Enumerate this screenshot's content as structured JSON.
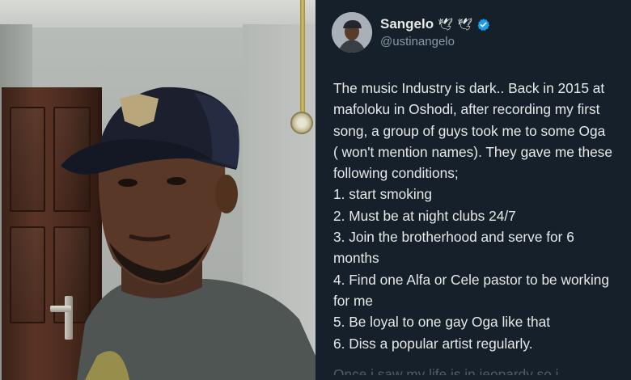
{
  "tweet": {
    "display_name": "Sangelo",
    "name_emojis": [
      "🕊",
      "🕊"
    ],
    "verified": true,
    "handle": "@ustinangelo",
    "lines": [
      "The music Industry is dark.. Back in 2015 at",
      "mafoloku in Oshodi, after recording my first",
      "song,  a group of guys took me to some Oga",
      "( won't mention names). They gave me these",
      "following conditions;",
      "1.  start smoking",
      "2. Must be at night clubs 24/7",
      "3. Join the brotherhood and serve for 6",
      "months",
      "4. Find one Alfa or Cele pastor to be working",
      "for me",
      "5. Be loyal to one gay Oga like that",
      "6. Diss a popular artist regularly."
    ],
    "cutoff_line": "Once i saw my life is in jeopardy so i"
  },
  "colors": {
    "tweet_bg": "#15202b",
    "text": "#e7e9ea",
    "muted": "#8b98a5",
    "verified": "#1d9bf0"
  }
}
